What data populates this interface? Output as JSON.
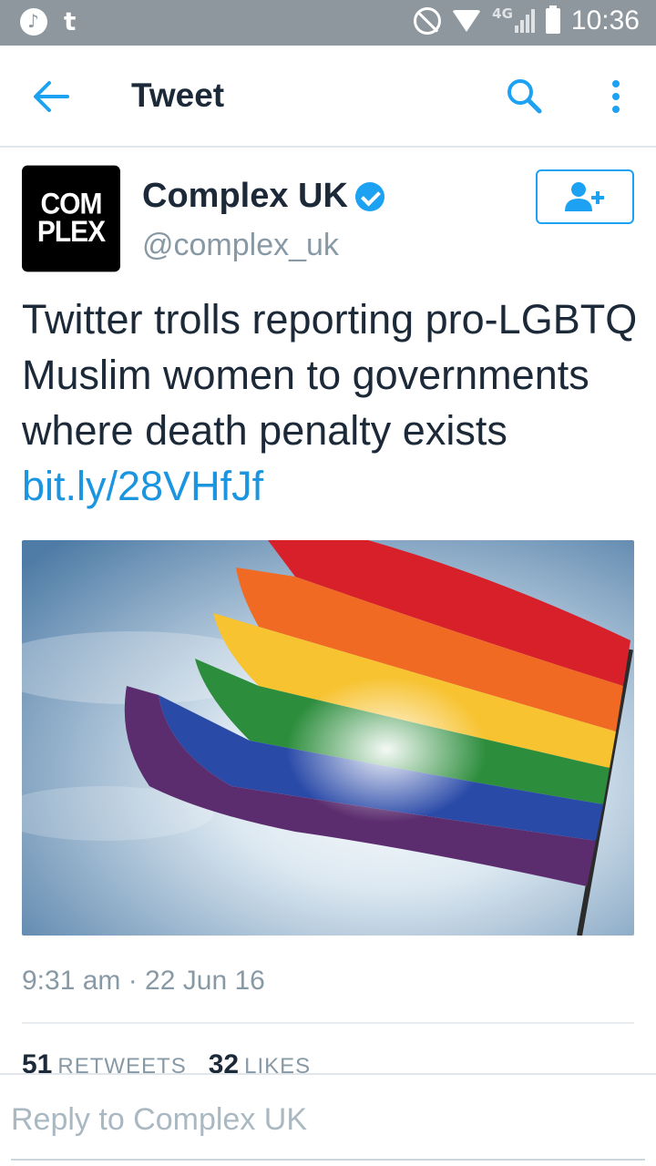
{
  "status_bar": {
    "tumblr_glyph": "t",
    "network_label": "4G",
    "time": "10:36"
  },
  "app_bar": {
    "title": "Tweet",
    "icons": [
      "back-arrow-icon",
      "search-icon",
      "more-vertical-icon"
    ]
  },
  "tweet": {
    "avatar_line1": "COM",
    "avatar_line2": "PLEX",
    "display_name": "Complex UK",
    "handle": "@complex_uk",
    "text": "Twitter trolls reporting pro-LGBTQ Muslim women to governments where death penalty exists ",
    "link": "bit.ly/28VHfJf",
    "media_description_icon": "rainbow-flag-photo",
    "timestamp": "9:31 am · 22 Jun 16",
    "retweets_count": "51",
    "retweets_label": "RETWEETS",
    "likes_count": "32",
    "likes_label": "LIKES"
  },
  "reply": {
    "placeholder": "Reply to Complex UK"
  },
  "colors": {
    "accent": "#1da1f2",
    "link": "#1b95e0",
    "status_bar": "#8e979d",
    "text_primary": "#1c2938",
    "text_secondary": "#8899a6"
  }
}
